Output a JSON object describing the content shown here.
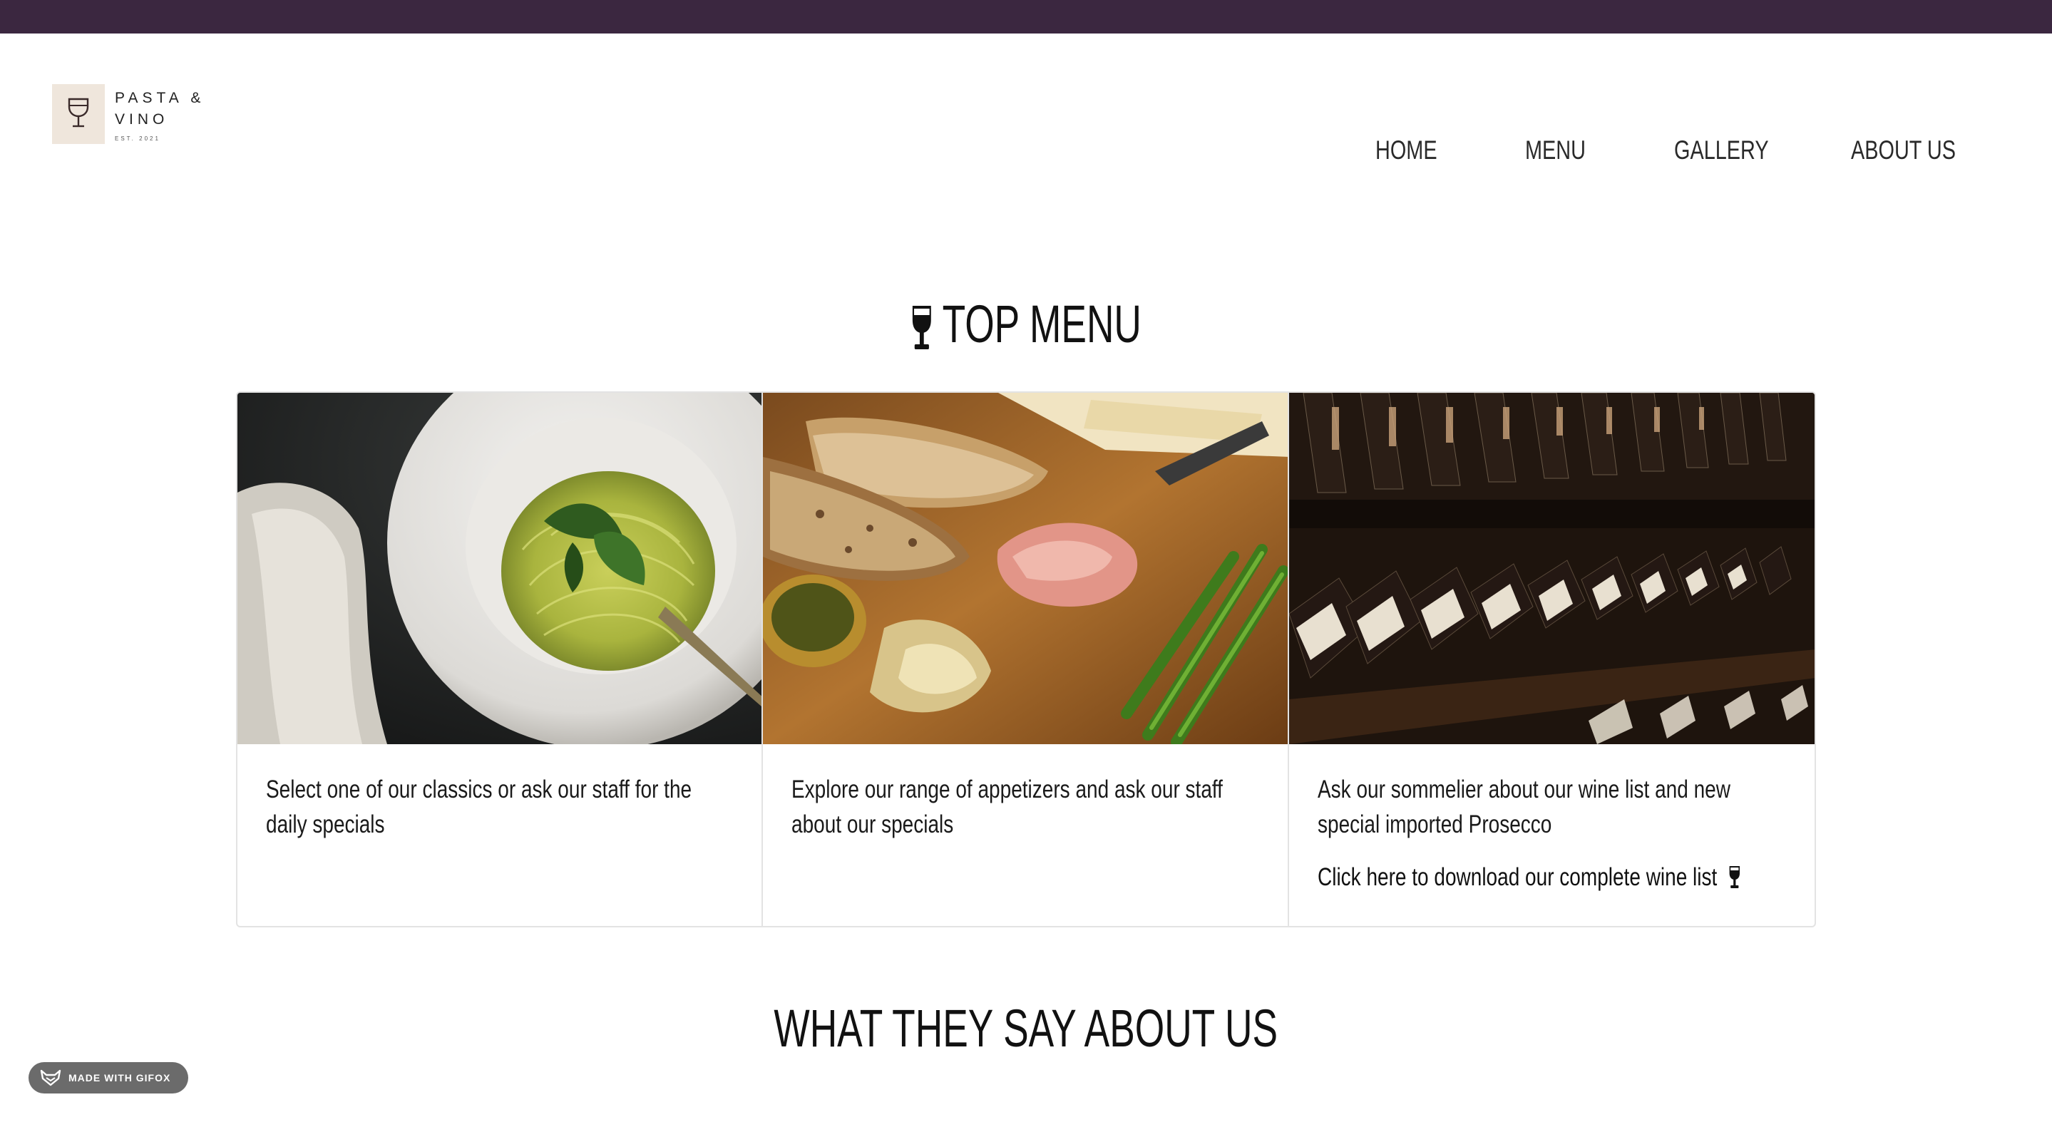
{
  "brand": {
    "line1": "PASTA &",
    "line2": "VINO",
    "est": "EST. 2021",
    "logo_icon": "wine-glass-icon",
    "topbar_color": "#3b2740",
    "logo_bg": "#efe6dc"
  },
  "nav": {
    "items": [
      {
        "label": "HOME"
      },
      {
        "label": "MENU"
      },
      {
        "label": "GALLERY"
      },
      {
        "label": "ABOUT US"
      }
    ]
  },
  "top_menu": {
    "title": "TOP MENU",
    "title_icon": "wine-glass-icon",
    "cards": [
      {
        "image": "pesto-spaghetti-photo",
        "text": "Select one of our classics or ask our staff for the daily specials"
      },
      {
        "image": "bread-prosciutto-board-photo",
        "text": "Explore our range of appetizers and ask our staff about our specials"
      },
      {
        "image": "wine-bottles-rack-photo",
        "text": "Ask our sommelier about our wine list and new special imported Prosecco",
        "link": "Click here to download our complete wine list",
        "link_icon": "wine-glass-icon"
      }
    ]
  },
  "testimonials": {
    "title": "WHAT THEY SAY ABOUT US"
  },
  "badge": {
    "label": "MADE WITH GIFOX",
    "icon": "fox-icon"
  }
}
